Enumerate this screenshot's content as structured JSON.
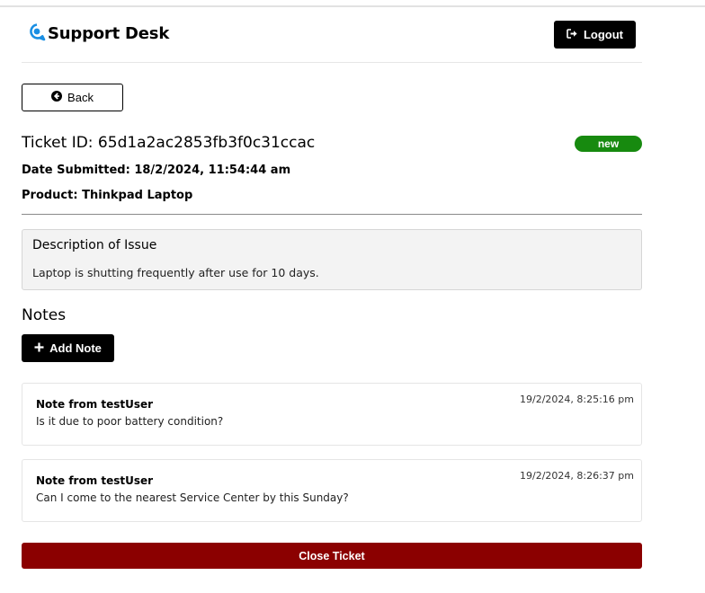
{
  "header": {
    "logo_icon": "question-bubble-icon",
    "app_title": "Support Desk",
    "logout_label": "Logout",
    "logout_icon": "sign-out-icon"
  },
  "back": {
    "label": "Back",
    "icon": "arrow-circle-left-icon"
  },
  "ticket": {
    "id_text": "Ticket ID: 65d1a2ac2853fb3f0c31ccac",
    "status": "new",
    "date_submitted": "Date Submitted: 18/2/2024, 11:54:44 am",
    "product": "Product: Thinkpad Laptop",
    "description_title": "Description of Issue",
    "description": "Laptop is shutting frequently after use for 10 days."
  },
  "notes": {
    "heading": "Notes",
    "add_note_label": "Add Note",
    "add_note_icon": "plus-icon",
    "items": [
      {
        "author": "Note from testUser",
        "text": "Is it due to poor battery condition?",
        "date": "19/2/2024, 8:25:16 pm"
      },
      {
        "author": "Note from testUser",
        "text": "Can I come to the nearest Service Center by this Sunday?",
        "date": "19/2/2024, 8:26:37 pm"
      }
    ]
  },
  "actions": {
    "close_ticket_label": "Close Ticket"
  },
  "colors": {
    "status_new": "#178a0f",
    "close_button": "#8b0000",
    "logo_blue": "#1a8fe3",
    "primary_button": "#000000"
  }
}
